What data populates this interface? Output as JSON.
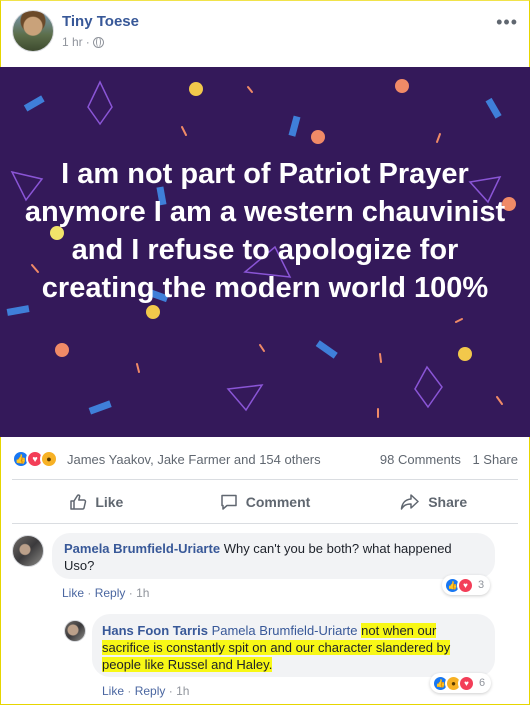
{
  "post": {
    "author": "Tiny Toese",
    "time": "1 hr",
    "banner_text": "I am not part of Patriot Prayer anymore I am a western chauvinist and I refuse to apologize for creating the modern world 100%",
    "banner_color": "#34195a"
  },
  "summary": {
    "reaction_icons": [
      "like-icon",
      "love-icon",
      "wow-icon"
    ],
    "likers": "James Yaakov, Jake Farmer and 154 others",
    "comments": "98 Comments",
    "shares": "1 Share"
  },
  "actions": {
    "like": "Like",
    "comment": "Comment",
    "share": "Share"
  },
  "comments": [
    {
      "name": "Pamela Brumfield-Uriarte",
      "text": "Why can't you be both? what happened Uso?",
      "like": "Like",
      "reply": "Reply",
      "time": "1h",
      "reaction_icons": [
        "like-icon",
        "love-icon"
      ],
      "reaction_count": "3"
    },
    {
      "name": "Hans Foon Tarris",
      "mention": "Pamela Brumfield-Uriarte",
      "text": "not when our sacrifice is constantly spit on and our character slandered by people like Russel and Haley.",
      "like": "Like",
      "reply": "Reply",
      "time": "1h",
      "reaction_icons": [
        "like-icon",
        "wow-icon",
        "love-icon"
      ],
      "reaction_count": "6"
    }
  ],
  "colors": {
    "link": "#385898",
    "highlight": "#f8f816",
    "like": "#1877f2",
    "love": "#f33e58",
    "wow": "#f7b125"
  }
}
